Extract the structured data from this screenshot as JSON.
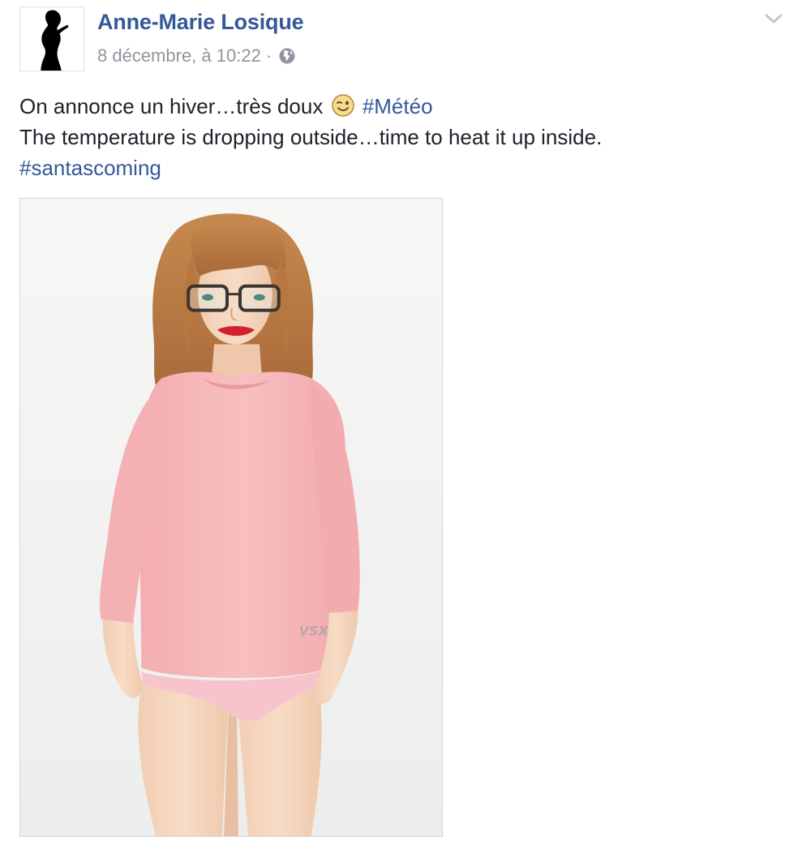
{
  "post": {
    "author": "Anne-Marie Losique",
    "timestamp": "8 décembre, à 10:22",
    "separator": "·",
    "privacy_icon": "globe-icon",
    "options_icon": "chevron-down-icon",
    "message": {
      "line1_text": "On annonce un hiver…très doux",
      "line1_emoji": "wink-emoji",
      "line1_hashtag": "#Météo",
      "line2_text": "The temperature is dropping outside…time to heat it up inside.",
      "line3_hashtag": "#santascoming"
    },
    "photo": {
      "sweater_print": "VSX"
    }
  },
  "colors": {
    "link": "#365899",
    "text": "#1d2129",
    "meta": "#90949c",
    "border": "#dddfe2"
  }
}
